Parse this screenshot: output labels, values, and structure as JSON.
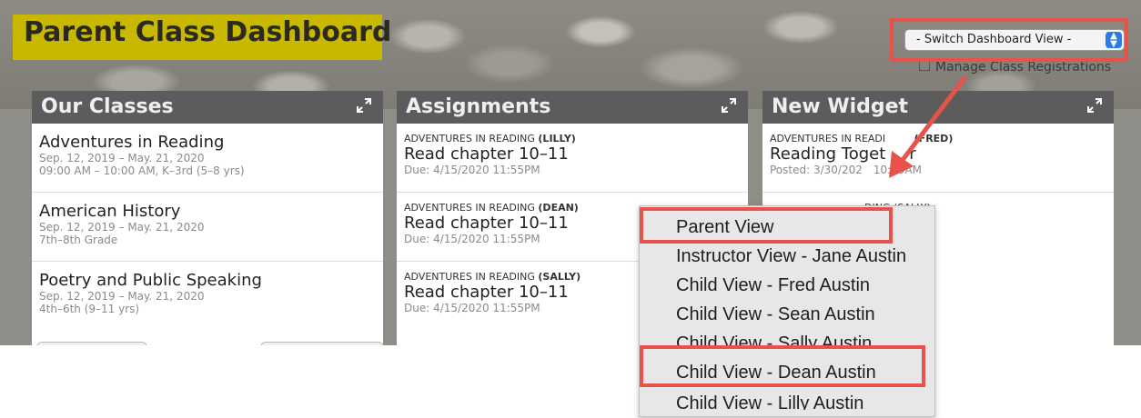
{
  "header": {
    "title": "Parent Class Dashboard"
  },
  "switch_view": {
    "selected": "- Switch Dashboard View -"
  },
  "manage_link": "Manage Class Registrations",
  "panels": {
    "classes": {
      "title": "Our Classes",
      "items": [
        {
          "name": "Adventures in Reading",
          "dates": "Sep. 12, 2019 – May. 21, 2020",
          "details": "09:00 AM – 10:00 AM, K–3rd (5–8 yrs)"
        },
        {
          "name": "American History",
          "dates": "Sep. 12, 2019 – May. 21, 2020",
          "details": "7th–8th Grade"
        },
        {
          "name": "Poetry and Public Speaking",
          "dates": "Sep. 12, 2019 – May. 21, 2020",
          "details": "4th–6th (9–11 yrs)"
        }
      ]
    },
    "assignments": {
      "title": "Assignments",
      "items": [
        {
          "class": "ADVENTURES IN READING",
          "student": "(LILLY)",
          "title": "Read chapter 10–11",
          "due": "Due: 4/15/2020 11:55PM"
        },
        {
          "class": "ADVENTURES IN READING",
          "student": "(DEAN)",
          "title": "Read chapter 10–11",
          "due": "Due: 4/15/2020 11:55PM"
        },
        {
          "class": "ADVENTURES IN READING",
          "student": "(SALLY)",
          "title": "Read chapter 10–11",
          "due": "Due: 4/15/2020 11:55PM"
        }
      ]
    },
    "widget": {
      "title": "New Widget",
      "items": [
        {
          "class": "ADVENTURES IN READI",
          "student": "(FRED)",
          "title": "Reading Toget",
          "title_end": "r",
          "posted": "Posted: 3/30/202",
          "posted_end": "10:00AM"
        },
        {
          "class": "",
          "student": "DING (SALLY)",
          "title": "",
          "posted": ""
        }
      ]
    }
  },
  "dropdown_menu": {
    "options": [
      "Parent View",
      "Instructor View - Jane Austin",
      "Child View - Fred Austin",
      "Child View - Sean Austin",
      "Child View - Sally Austin",
      "Child View - Dean Austin",
      "Child View - Lilly Austin"
    ],
    "highlighted": [
      "Parent View",
      "Child View - Dean Austin"
    ]
  },
  "colors": {
    "title_bg": "#c9b800",
    "panel_header": "#5c5c5c",
    "highlight": "#e8524a",
    "stepper": "#2d7be5"
  },
  "icons": {
    "expand": "expand-arrows-icon",
    "stepper": "up-down-chevron-icon"
  }
}
